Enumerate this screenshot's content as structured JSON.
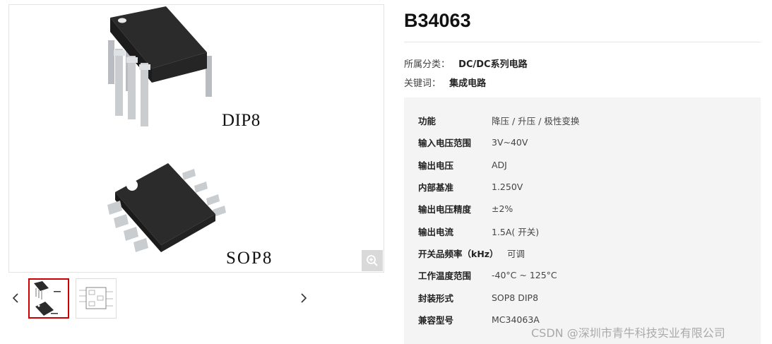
{
  "gallery": {
    "main_image_labels": {
      "dip": "DIP8",
      "sop": "SOP8"
    },
    "zoom_icon": "zoom-in-icon",
    "thumbnails": [
      {
        "name": "chip-packages-thumbnail",
        "selected": true
      },
      {
        "name": "circuit-diagram-thumbnail",
        "selected": false
      }
    ],
    "nav_icons": {
      "prev": "chevron-left-icon",
      "next": "chevron-right-icon"
    }
  },
  "product": {
    "title": "B34063",
    "category_label": "所属分类：",
    "category_value": "DC/DC系列电路",
    "keywords_label": "关键词：",
    "keywords_value": "集成电路"
  },
  "specs": [
    {
      "label": "功能",
      "value": "降压 / 升压 / 极性变换"
    },
    {
      "label": "输入电压范围",
      "value": "3V~40V"
    },
    {
      "label": "输出电压",
      "value": "ADJ"
    },
    {
      "label": "内部基准",
      "value": "1.250V"
    },
    {
      "label": "输出电压精度",
      "value": "±2%"
    },
    {
      "label": "输出电流",
      "value": "1.5A( 开关)"
    },
    {
      "label": "开关品频率（kHz）",
      "value": "可调"
    },
    {
      "label": "工作温度范围",
      "value": "-40°C ~ 125°C"
    },
    {
      "label": "封装形式",
      "value": "SOP8 DIP8"
    },
    {
      "label": "兼容型号",
      "value": "MC34063A"
    }
  ],
  "watermark": "CSDN @深圳市青牛科技实业有限公司",
  "colors": {
    "accent": "#cc0000",
    "spec_bg": "#f4f4f4",
    "chip_body": "#2a2a2a",
    "pin": "#c9cdd0"
  }
}
